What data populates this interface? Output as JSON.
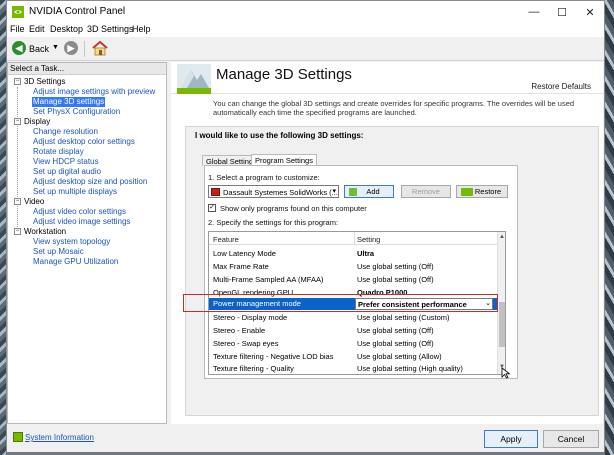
{
  "window": {
    "title": "NVIDIA Control Panel"
  },
  "menu": [
    "File",
    "Edit",
    "Desktop",
    "3D Settings",
    "Help"
  ],
  "toolbar": {
    "back_label": "Back"
  },
  "task_panel": {
    "header": "Select a Task...",
    "categories": [
      {
        "label": "3D Settings",
        "items": [
          "Adjust image settings with preview",
          "Manage 3D settings",
          "Set PhysX Configuration"
        ]
      },
      {
        "label": "Display",
        "items": [
          "Change resolution",
          "Adjust desktop color settings",
          "Rotate display",
          "View HDCP status",
          "Set up digital audio",
          "Adjust desktop size and position",
          "Set up multiple displays"
        ]
      },
      {
        "label": "Video",
        "items": [
          "Adjust video color settings",
          "Adjust video image settings"
        ]
      },
      {
        "label": "Workstation",
        "items": [
          "View system topology",
          "Set up Mosaic",
          "Manage GPU Utilization"
        ]
      }
    ],
    "selected_item": "Manage 3D settings"
  },
  "main": {
    "title": "Manage 3D Settings",
    "restore_defaults": "Restore Defaults",
    "description": "You can change the global 3D settings and create overrides for specific programs. The overrides will be used automatically each time the specified programs are launched.",
    "group_title": "I would like to use the following 3D settings:",
    "tabs": [
      "Global Settings",
      "Program Settings"
    ],
    "active_tab": "Program Settings",
    "select_program_label": "1. Select a program to customize:",
    "selected_program": "Dassault Systemes SolidWorks (...",
    "add_label": "Add",
    "remove_label": "Remove",
    "restore_label": "Restore",
    "show_only_label": "Show only programs found on this computer",
    "show_only_checked": true,
    "specify_label": "2. Specify the settings for this program:",
    "table": {
      "headers": [
        "Feature",
        "Setting"
      ],
      "rows": [
        {
          "feature": "Low Latency Mode",
          "setting": "Ultra",
          "bold": true
        },
        {
          "feature": "Max Frame Rate",
          "setting": "Use global setting (Off)",
          "bold": false
        },
        {
          "feature": "Multi-Frame Sampled AA (MFAA)",
          "setting": "Use global setting (Off)",
          "bold": false
        },
        {
          "feature": "OpenGL rendering GPU",
          "setting": "Quadro P1000",
          "bold": true
        },
        {
          "feature": "Power management mode",
          "setting": "Prefer consistent performance",
          "bold": true,
          "selected": true
        },
        {
          "feature": "Stereo - Display mode",
          "setting": "Use global setting (Custom)",
          "bold": false
        },
        {
          "feature": "Stereo - Enable",
          "setting": "Use global setting (Off)",
          "bold": false
        },
        {
          "feature": "Stereo - Swap eyes",
          "setting": "Use global setting (Off)",
          "bold": false
        },
        {
          "feature": "Texture filtering - Negative LOD bias",
          "setting": "Use global setting (Allow)",
          "bold": false
        },
        {
          "feature": "Texture filtering - Quality",
          "setting": "Use global setting (High quality)",
          "bold": false
        }
      ]
    }
  },
  "footer": {
    "system_info": "System Information",
    "apply": "Apply",
    "cancel": "Cancel"
  },
  "colors": {
    "nvidia_green": "#76b900",
    "selection_blue": "#0a63c9",
    "highlight_red": "#d02828"
  }
}
